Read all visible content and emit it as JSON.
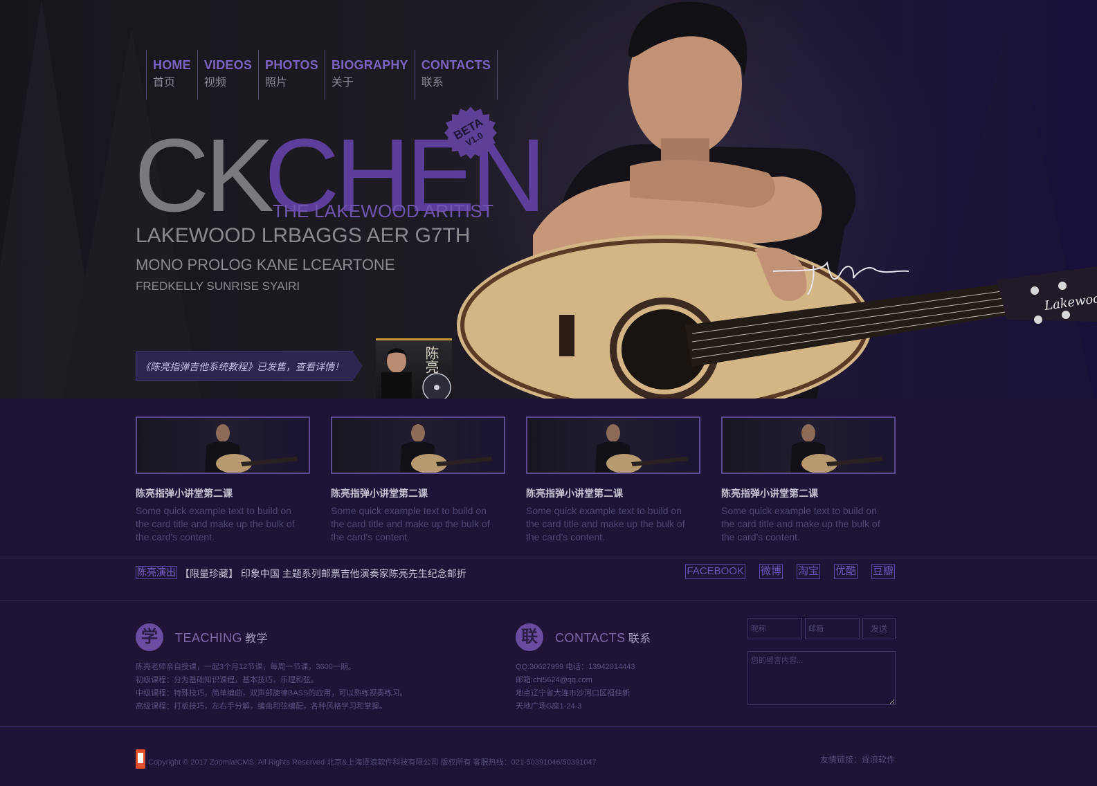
{
  "nav": {
    "items": [
      {
        "en": "HOME",
        "cn": "首页"
      },
      {
        "en": "VIDEOS",
        "cn": "视频"
      },
      {
        "en": "PHOTOS",
        "cn": "照片"
      },
      {
        "en": "BIOGRAPHY",
        "cn": "关于"
      },
      {
        "en": "CONTACTS",
        "cn": "联系"
      }
    ]
  },
  "hero": {
    "logo_gray": "CK",
    "logo_purple": "CHEN",
    "subtitle": "THE LAKEWOOD ARITIST",
    "beta_label": "BETA",
    "beta_version": "V1.0",
    "line1": "LAKEWOOD LRBAGGS AER G7TH",
    "line2": "MONO PROLOG KANE LCEARTONE",
    "line3": "FREDKELLY SUNRISE SYAIRI",
    "promo": "《陈亮指弹吉他系统教程》已发售，查看详情！",
    "album_title": "陈亮",
    "guitar_brand": "Lakewood"
  },
  "cards": [
    {
      "title": "陈亮指弹小讲堂第二课",
      "text": "Some quick example text to build on the card title and make up the bulk of the card's content."
    },
    {
      "title": "陈亮指弹小讲堂第二课",
      "text": "Some quick example text to build on the card title and make up the bulk of the card's content."
    },
    {
      "title": "陈亮指弹小讲堂第二课",
      "text": "Some quick example text to build on the card title and make up the bulk of the card's content."
    },
    {
      "title": "陈亮指弹小讲堂第二课",
      "text": "Some quick example text to build on the card title and make up the bulk of the card's content."
    }
  ],
  "news": {
    "tag": "陈亮演出",
    "text": "【限量珍藏】 印象中国 主题系列邮票吉他演奏家陈亮先生纪念邮折"
  },
  "social": [
    "FACEBOOK",
    "微博",
    "淘宝",
    "优酷",
    "豆瓣"
  ],
  "teaching": {
    "badge": "学",
    "title_en": "TEACHING",
    "title_cn": "教学",
    "lines": [
      "陈亮老师亲自授课，一起3个月12节课，每周一节课，3600一期。",
      "初级课程：分为基础知识课程，基本技巧，乐理和弦。",
      "中级课程：特殊技巧，简单编曲，双声部旋律BASS的应用，可以熟练视奏练习。",
      "高级课程：打板技巧，左右手分解，编曲和弦编配，各种风格学习和掌握。"
    ]
  },
  "contacts": {
    "badge": "联",
    "title_en": "CONTACTS",
    "title_cn": "联系",
    "lines": [
      "QQ:30627999 电话：13942014443",
      "邮箱:chl5624@qq.com",
      "地点辽宁省大连市沙河口区福佳新",
      "天地广场G座1-24-3"
    ]
  },
  "form": {
    "nickname_placeholder": "昵称",
    "email_placeholder": "邮箱",
    "send_label": "发送",
    "message_placeholder": "您的留言内容..."
  },
  "footer": {
    "copyright": "Copyright © 2017 Zoomla!CMS. All Rights Reserved 北京&上海逐浪软件科技有限公司 版权所有 客服热线：021-50391046/50391047",
    "friend_links": "友情链接：逐浪软件"
  },
  "colors": {
    "accent": "#6a4ca0",
    "background": "#1f1437",
    "nav_text": "#7c63c2"
  }
}
